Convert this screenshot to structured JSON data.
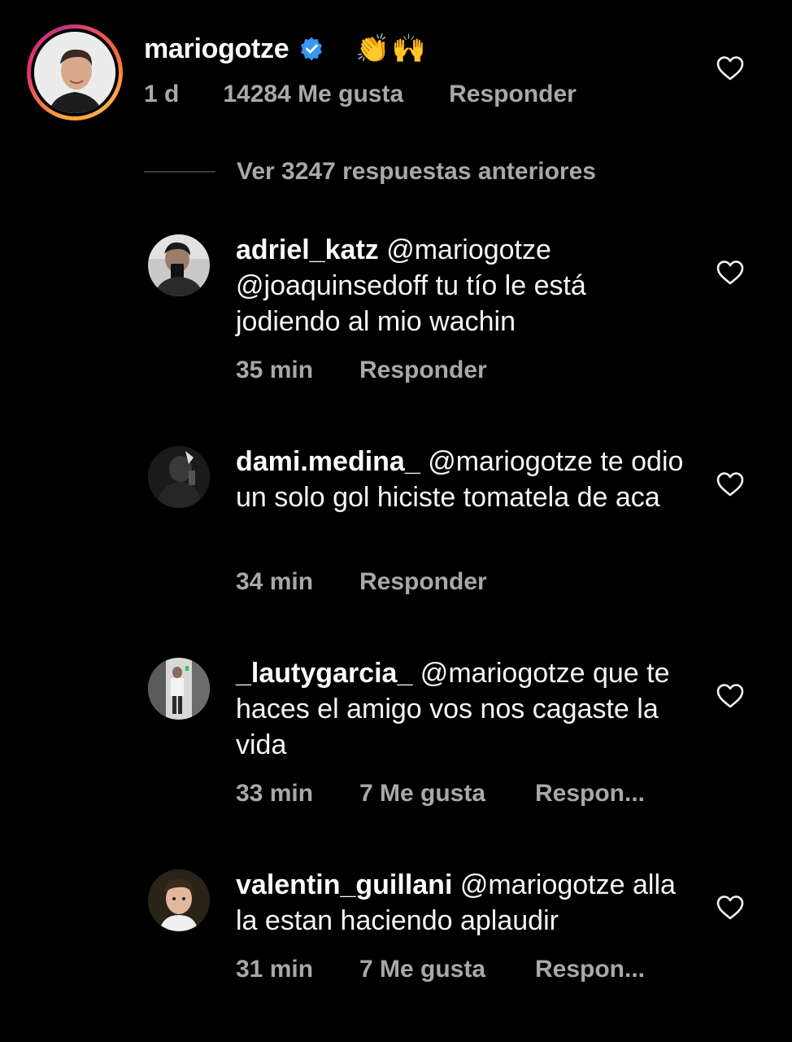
{
  "top_comment": {
    "username": "mariogotze",
    "emoji": "👏🙌",
    "time": "1 d",
    "likes": "14284 Me gusta",
    "reply_label": "Responder"
  },
  "view_previous": {
    "label": "Ver 3247 respuestas anteriores"
  },
  "replies": [
    {
      "username": "adriel_katz",
      "text": " @mariogotze @joaquinsedoff tu tío le está jodiendo al mio wachin",
      "time": "35 min",
      "likes": "",
      "reply_label": "Responder"
    },
    {
      "username": "dami.medina_",
      "text": " @mariogotze te odio un solo gol hiciste tomatela de aca",
      "time": "34 min",
      "likes": "",
      "reply_label": "Responder"
    },
    {
      "username": "_lautygarcia_",
      "text": " @mariogotze que te haces el amigo vos nos cagaste la vida",
      "time": "33 min",
      "likes": "7 Me gusta",
      "reply_label": "Respon..."
    },
    {
      "username": "valentin_guillani",
      "text": " @mariogotze alla la estan haciendo aplaudir",
      "time": "31 min",
      "likes": "7 Me gusta",
      "reply_label": "Respon..."
    }
  ],
  "colors": {
    "background": "#000000",
    "text_primary": "#f5f5f5",
    "text_secondary": "#a8a8a8",
    "verified": "#3897f0"
  },
  "icons": {
    "like": "heart-outline-icon",
    "verified": "verified-badge-icon"
  }
}
